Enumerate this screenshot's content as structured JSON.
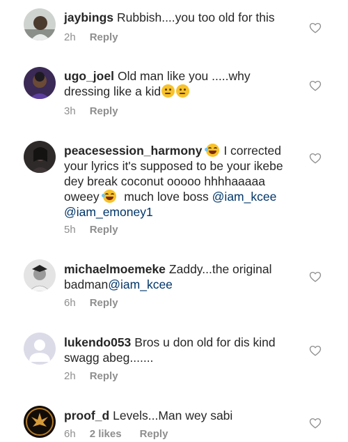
{
  "comments": [
    {
      "username": "jaybings",
      "text": "Rubbish....you too old for this",
      "time": "2h",
      "reply": "Reply"
    },
    {
      "username": "ugo_joel",
      "text": "Old man like you .....why dressing like a kid",
      "emojis": [
        "thinking-face",
        "thinking-face"
      ],
      "time": "3h",
      "reply": "Reply"
    },
    {
      "username": "peacesession_harmony",
      "text_part1": "I corrected your lyrics it's supposed to be your ikebe dey break coconut ooooo  hhhhaaaaa oweey",
      "text_part2": "much love boss",
      "mention1": "@iam_kcee",
      "mention2": "@iam_emoney1",
      "emojis": [
        "laughing-tears-face",
        "laughing-tears-face"
      ],
      "time": "5h",
      "reply": "Reply"
    },
    {
      "username": "michaelmoemeke",
      "text": "Zaddy...the original badman",
      "mention": "@iam_kcee",
      "time": "6h",
      "reply": "Reply"
    },
    {
      "username": "lukendo053",
      "text": "Bros u don old for dis  kind swagg abeg.......",
      "time": "2h",
      "reply": "Reply"
    },
    {
      "username": "proof_d",
      "text": "Levels...Man wey sabi",
      "time": "6h",
      "likes": "2 likes",
      "reply": "Reply"
    }
  ],
  "colors": {
    "text": "#262626",
    "meta": "#8e8e8e",
    "mention": "#003569",
    "heart_stroke": "#8e8e8e"
  }
}
